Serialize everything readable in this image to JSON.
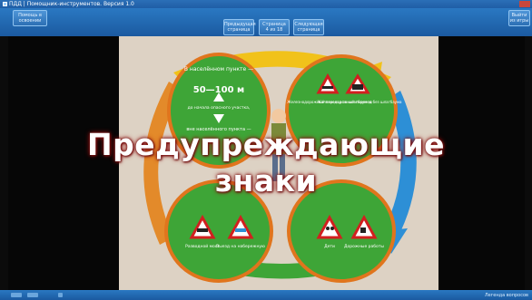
{
  "window": {
    "title": "ПДД | Помощник-инструментов. Версия 1.0"
  },
  "toolbar": {
    "left_button": "Помощь в\nосвоении",
    "center_buttons": [
      {
        "label": "Предыдущая\nстраница"
      },
      {
        "label": "Страница\n4 из 18"
      },
      {
        "label": "Следующая\nстраница"
      }
    ],
    "right_button": "Выйти\nиз игры"
  },
  "slide": {
    "top_left_oval": {
      "line1": "В населённом\nпункте —",
      "distance": "50—100 м",
      "line2": "до начала опасного участка,",
      "line3": "вне населённого\nпункта —"
    },
    "top_right_oval": {
      "sign1_label": "Железнодорожный\nпереезд со\nшлагбаумом",
      "sign2_label": "Железнодорожный\nпереезд без\nшлагбаума"
    },
    "bottom_left_oval": {
      "sign1_label": "Разводной\nмост",
      "sign2_label": "Выезд на\nнабережную"
    },
    "bottom_right_oval": {
      "sign1_label": "Дети",
      "sign2_label": "Дорожные\nработы"
    }
  },
  "overlay": {
    "line1": "Предупреждающие",
    "line2": "знаки"
  },
  "statusbar": {
    "right_text": "Легенда вопросов"
  },
  "colors": {
    "accent_blue": "#1f5ea6",
    "oval_green": "#3ea537",
    "oval_border": "#e0751d",
    "sign_red": "#d21f1f"
  }
}
